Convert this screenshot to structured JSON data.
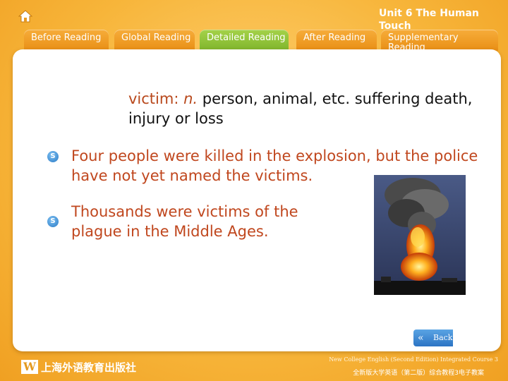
{
  "header": {
    "home_icon": "home-icon",
    "unit_title": "Unit 6 The Human Touch"
  },
  "tabs": [
    {
      "label": "Before Reading",
      "active": false
    },
    {
      "label": "Global Reading",
      "active": false
    },
    {
      "label": "Detailed Reading",
      "active": true
    },
    {
      "label": "After Reading",
      "active": false
    },
    {
      "label": "Supplementary Reading",
      "active": false
    }
  ],
  "definition": {
    "word": "victim:",
    "pos": "n.",
    "meaning": "person, animal, etc. suffering death, injury or loss"
  },
  "examples": [
    {
      "bullet": "S",
      "text": "Four people were killed in the explosion, but the police have not yet named the victims."
    },
    {
      "bullet": "S",
      "text": "Thousands were victims of the plague in the Middle Ages."
    }
  ],
  "back_button": {
    "label": "Back",
    "icon": "double-chevron-left-icon"
  },
  "footer": {
    "publisher_logo_mark": "W",
    "publisher": "上海外语教育出版社",
    "course_en": "New College English (Second Edition) Integrated Course 3",
    "course_cn": "全新版大学英语（第二版）综合教程3电子教案"
  },
  "colors": {
    "accent": "#b8481c",
    "tab_active": "#8bbf34",
    "tab": "#f0a02a"
  }
}
